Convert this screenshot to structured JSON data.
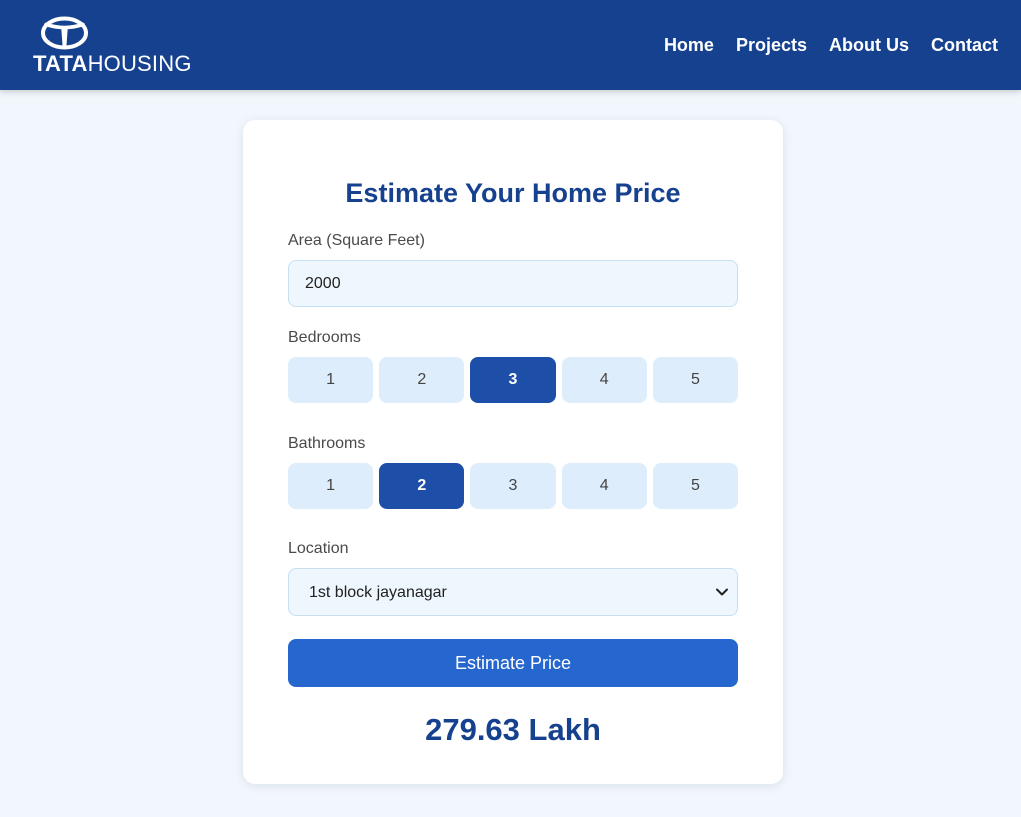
{
  "brand": {
    "logo_word_bold": "TATA",
    "logo_word_light": "HOUSING",
    "logo_icon": "tata-logo-icon"
  },
  "nav": {
    "items": [
      {
        "label": "Home"
      },
      {
        "label": "Projects"
      },
      {
        "label": "About Us"
      },
      {
        "label": "Contact"
      }
    ]
  },
  "form": {
    "title": "Estimate Your Home Price",
    "area": {
      "label": "Area (Square Feet)",
      "value": "2000"
    },
    "bedrooms": {
      "label": "Bedrooms",
      "options": [
        "1",
        "2",
        "3",
        "4",
        "5"
      ],
      "selected": "3"
    },
    "bathrooms": {
      "label": "Bathrooms",
      "options": [
        "1",
        "2",
        "3",
        "4",
        "5"
      ],
      "selected": "2"
    },
    "location": {
      "label": "Location",
      "value": "1st block jayanagar",
      "icon": "chevron-down-icon"
    },
    "submit_label": "Estimate Price",
    "result": "279.63 Lakh"
  },
  "colors": {
    "navbar": "#15418e",
    "page_bg": "#f1f7fc",
    "accent": "#2666cf",
    "selected_option": "#1d4fa8",
    "option_bg": "#deedfb",
    "heading": "#15418e"
  }
}
